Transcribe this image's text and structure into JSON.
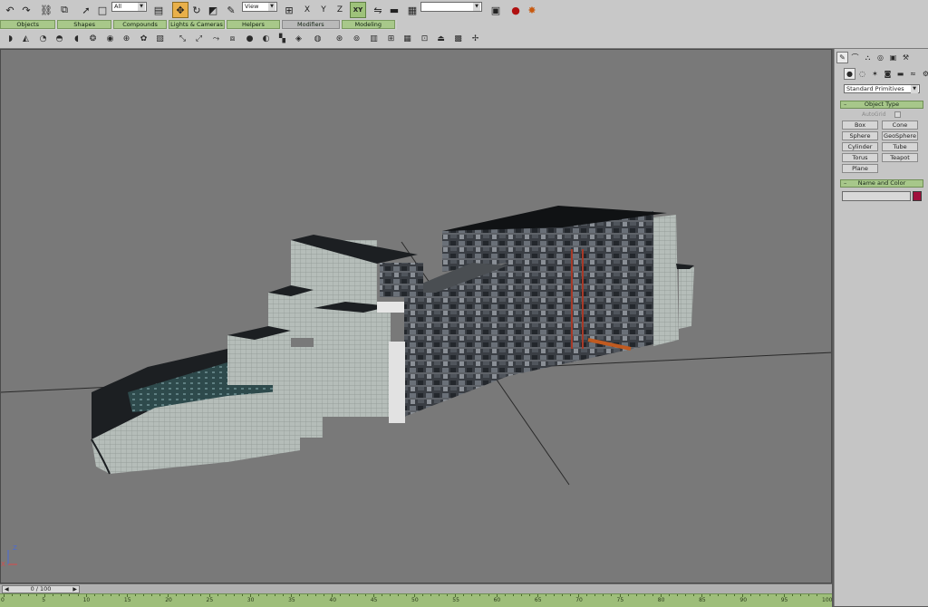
{
  "toolbar": {
    "selection_filter": "All",
    "ref_coord": "View",
    "named_selection": "",
    "axis_x": "X",
    "axis_y": "Y",
    "axis_z": "Z",
    "axis_xy": "XY"
  },
  "tabs": [
    {
      "label": "Objects"
    },
    {
      "label": "Shapes"
    },
    {
      "label": "Compounds"
    },
    {
      "label": "Lights & Cameras"
    },
    {
      "label": "Helpers"
    },
    {
      "label": "Modifiers"
    },
    {
      "label": "Modeling"
    }
  ],
  "command_panel": {
    "category_dropdown": "Standard Primitives",
    "object_type_title": "Object Type",
    "autogrid_label": "AutoGrid",
    "primitives": [
      {
        "label": "Box"
      },
      {
        "label": "Cone"
      },
      {
        "label": "Sphere"
      },
      {
        "label": "GeoSphere"
      },
      {
        "label": "Cylinder"
      },
      {
        "label": "Tube"
      },
      {
        "label": "Torus"
      },
      {
        "label": "Teapot"
      },
      {
        "label": "Plane"
      }
    ],
    "name_color_title": "Name and Color",
    "name_value": "",
    "object_color": "#a0103c"
  },
  "timeline": {
    "frame_display": "0 / 100",
    "ticks": [
      "0",
      "5",
      "10",
      "15",
      "20",
      "25",
      "30",
      "35",
      "40",
      "45",
      "50",
      "55",
      "60",
      "65",
      "70",
      "75",
      "80",
      "85",
      "90",
      "95",
      "100"
    ]
  },
  "viewport": {
    "axis_z": "Z",
    "axis_x": "X"
  },
  "colors": {
    "ui_background": "#c8c8c8",
    "tab_green": "#a8c88a",
    "viewport_bg": "#797979",
    "active_tool": "#e9b04a"
  }
}
